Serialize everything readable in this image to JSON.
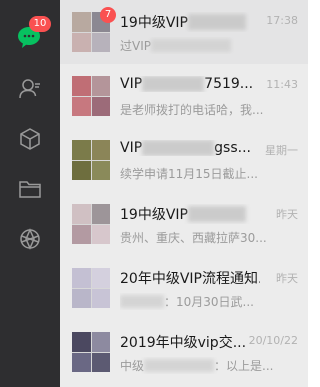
{
  "sidebar": {
    "chat_badge": "10",
    "items": [
      {
        "icon": "chat-icon",
        "active": true
      },
      {
        "icon": "contacts-icon"
      },
      {
        "icon": "favorites-cube-icon"
      },
      {
        "icon": "folder-icon"
      },
      {
        "icon": "moments-icon"
      }
    ]
  },
  "conversations": [
    {
      "title_pre": "19中级VIP",
      "title_post": "",
      "time": "17:38",
      "preview_pre": "过VIP",
      "preview_post": "",
      "badge": "7",
      "colors": [
        "#b8a9a0",
        "#8b8892",
        "#c9b1b0",
        "#b7b2bb"
      ]
    },
    {
      "title_pre": "VIP",
      "title_post": "7519...",
      "time": "11:43",
      "preview_pre": "是老师拨打的电话哈，我...",
      "preview_post": "",
      "badge": "",
      "colors": [
        "#c06e75",
        "#b4959a",
        "#c7787f",
        "#9c6b79"
      ]
    },
    {
      "title_pre": "VIP",
      "title_post": "gss...",
      "time": "星期一",
      "preview_pre": "续学申请11月15日截止...",
      "preview_post": "",
      "badge": "",
      "colors": [
        "#7b7b4a",
        "#8b8558",
        "#6e6e3e",
        "#8a8a5a"
      ]
    },
    {
      "title_pre": "19中级VIP",
      "title_post": "",
      "time": "昨天",
      "preview_pre": "贵州、重庆、西藏拉萨30...",
      "preview_post": "",
      "badge": "",
      "colors": [
        "#d0c0c3",
        "#9d9599",
        "#b39aa2",
        "#d7c7cc"
      ]
    },
    {
      "title_pre": "20年中级VIP流程通知...",
      "title_post": "",
      "time": "昨天",
      "preview_pre": "",
      "preview_post": "：10月30日武...",
      "badge": "",
      "colors": [
        "#c4c0d3",
        "#d4d0de",
        "#b9b6c9",
        "#c8c4d6"
      ]
    },
    {
      "title_pre": "2019年中级vip交...",
      "title_post": "",
      "time": "20/10/22",
      "preview_pre": "中级",
      "preview_post": "：以上是...",
      "badge": "",
      "colors": [
        "#4b4860",
        "#8d8aa0",
        "#6a6884",
        "#5c5a72"
      ]
    }
  ]
}
